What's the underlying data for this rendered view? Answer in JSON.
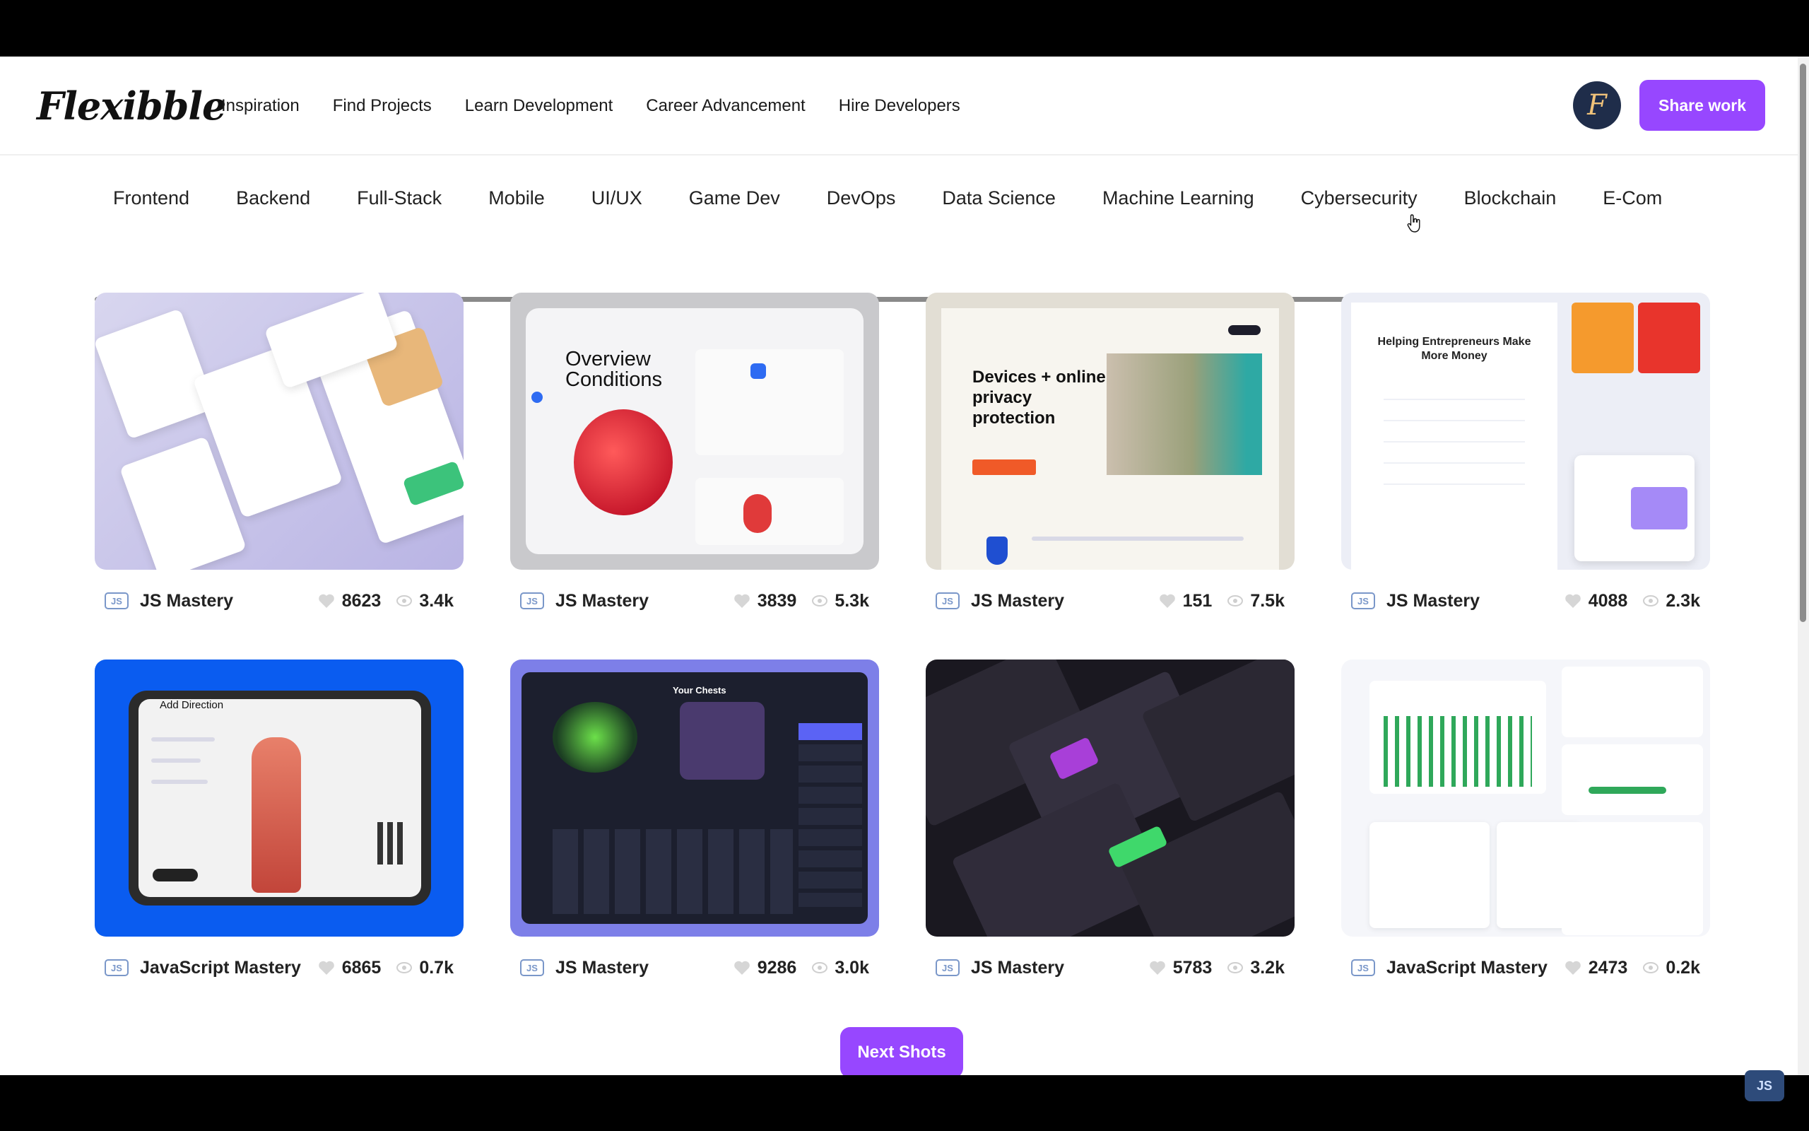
{
  "brand": {
    "logo_text": "Flexibble",
    "avatar_letter": "F",
    "share_label": "Share work"
  },
  "nav": {
    "links": [
      "Inspiration",
      "Find Projects",
      "Learn Development",
      "Career Advancement",
      "Hire Developers"
    ]
  },
  "categories": [
    "Frontend",
    "Backend",
    "Full-Stack",
    "Mobile",
    "UI/UX",
    "Game Dev",
    "DevOps",
    "Data Science",
    "Machine Learning",
    "Cybersecurity",
    "Blockchain",
    "E-Com"
  ],
  "projects": [
    {
      "author": "JS Mastery",
      "likes": "8623",
      "views": "3.4k"
    },
    {
      "author": "JS Mastery",
      "likes": "3839",
      "views": "5.3k",
      "thumb_title": "Overview Conditions"
    },
    {
      "author": "JS Mastery",
      "likes": "151",
      "views": "7.5k",
      "thumb_title": "Devices + online privacy protection"
    },
    {
      "author": "JS Mastery",
      "likes": "4088",
      "views": "2.3k",
      "thumb_title": "Helping Entrepreneurs Make More Money"
    },
    {
      "author": "JavaScript Mastery",
      "likes": "6865",
      "views": "0.7k",
      "thumb_title": "Add Direction"
    },
    {
      "author": "JS Mastery",
      "likes": "9286",
      "views": "3.0k",
      "thumb_title": "Your Chests"
    },
    {
      "author": "JS Mastery",
      "likes": "5783",
      "views": "3.2k"
    },
    {
      "author": "JavaScript Mastery",
      "likes": "2473",
      "views": "0.2k"
    }
  ],
  "pagination": {
    "next_label": "Next Shots"
  },
  "badge": {
    "js_text": "JS"
  },
  "colors": {
    "accent": "#9747ff",
    "avatar_bg": "#1f2d4a"
  }
}
